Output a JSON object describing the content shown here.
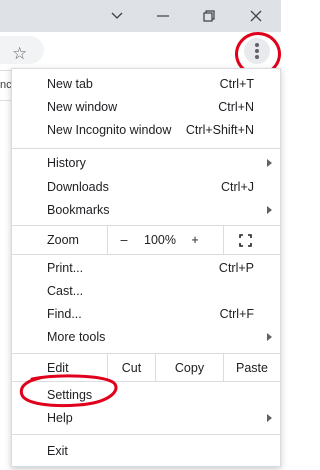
{
  "window": {
    "buttons": [
      "chevron-down",
      "minimize",
      "restore",
      "close"
    ]
  },
  "page": {
    "partial_text": "nc"
  },
  "menu": {
    "items": [
      {
        "label": "New tab",
        "shortcut": "Ctrl+T"
      },
      {
        "label": "New window",
        "shortcut": "Ctrl+N"
      },
      {
        "label": "New Incognito window",
        "shortcut": "Ctrl+Shift+N"
      },
      {
        "label": "History",
        "shortcut": ""
      },
      {
        "label": "Downloads",
        "shortcut": "Ctrl+J"
      },
      {
        "label": "Bookmarks",
        "shortcut": ""
      },
      {
        "label": "Print...",
        "shortcut": "Ctrl+P"
      },
      {
        "label": "Cast...",
        "shortcut": ""
      },
      {
        "label": "Find...",
        "shortcut": "Ctrl+F"
      },
      {
        "label": "More tools",
        "shortcut": ""
      },
      {
        "label": "Settings",
        "shortcut": ""
      },
      {
        "label": "Help",
        "shortcut": ""
      },
      {
        "label": "Exit",
        "shortcut": ""
      }
    ],
    "zoom": {
      "label": "Zoom",
      "minus": "–",
      "value": "100%",
      "plus": "+"
    },
    "edit": {
      "label": "Edit",
      "cut": "Cut",
      "copy": "Copy",
      "paste": "Paste"
    }
  },
  "annotations": {
    "color": "#e0001b"
  }
}
